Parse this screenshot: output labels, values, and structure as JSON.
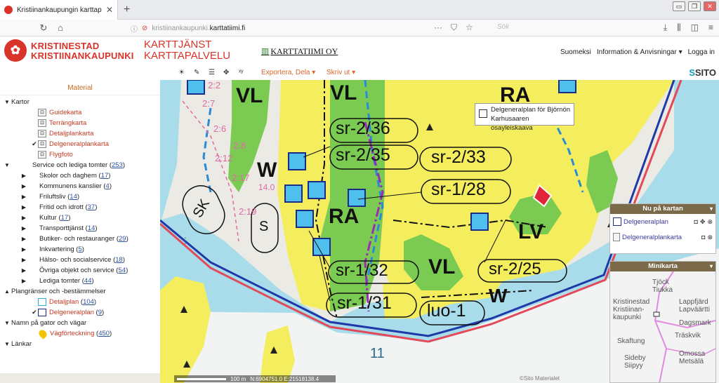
{
  "browser": {
    "tab_title": "Kristiinankaupungin karttapal",
    "url_prefix": "kristiinankaupunki.",
    "url_domain": "karttatiimi.fi",
    "search_placeholder": "Sök"
  },
  "header": {
    "city_line1": "KRISTINESTAD",
    "city_line2": "KRISTIINANKAUPUNKI",
    "service_line1": "KARTTJÄNST",
    "service_line2": "KARTTAPALVELU",
    "provider": "KARTTATIIMI OY",
    "links": [
      "Suomeksi",
      "Information & Anvisningar",
      "Logga in"
    ]
  },
  "toolbar": {
    "export_label": "Exportera, Dela",
    "print_label": "Skriv ut",
    "brand": "SITO"
  },
  "panel": {
    "title": "Material",
    "kartor_label": "Kartor",
    "maps": [
      {
        "label": "Guidekarta",
        "checked": false
      },
      {
        "label": "Terrängkarta",
        "checked": false
      },
      {
        "label": "Detaljplankarta",
        "checked": false
      },
      {
        "label": "Delgeneralplankarta",
        "checked": true
      },
      {
        "label": "Flygfoto",
        "checked": false
      }
    ],
    "service_label": "Service och lediga tomter",
    "service_count": "253",
    "service_items": [
      {
        "label": "Skolor och daghem",
        "count": "17"
      },
      {
        "label": "Kommunens kanslier",
        "count": "4"
      },
      {
        "label": "Friluftsliv",
        "count": "14"
      },
      {
        "label": "Fritid och idrott",
        "count": "37"
      },
      {
        "label": "Kultur",
        "count": "17"
      },
      {
        "label": "Transporttjänst",
        "count": "14"
      },
      {
        "label": "Butiker- och restauranger",
        "count": "29"
      },
      {
        "label": "Inkvartering",
        "count": "5"
      },
      {
        "label": "Hälso- och socialservice",
        "count": "18"
      },
      {
        "label": "Övriga objekt och service",
        "count": "54"
      },
      {
        "label": "Lediga tomter",
        "count": "44"
      }
    ],
    "plan_label": "Plangränser och -bestämmelser",
    "plan_items": [
      {
        "label": "Detaljplan",
        "count": "104",
        "checked": false
      },
      {
        "label": "Delgeneralplan",
        "count": "9",
        "checked": true
      }
    ],
    "roads_label": "Namn på gator och vägar",
    "roads_item": {
      "label": "Vägförteckning",
      "count": "450"
    },
    "links_label": "Länkar"
  },
  "map": {
    "tooltip_line1": "Delgeneralplan för Björnön",
    "tooltip_line2": "Karhusaaren osayleiskaava",
    "labels": [
      "sr-2/36",
      "sr-2/35",
      "sr-2/33",
      "sr-1/28",
      "sr-2/25",
      "sr-1/32",
      "sr-1/31",
      "luo-1",
      "VL",
      "VL",
      "VL",
      "RA",
      "RA",
      "W",
      "W",
      "LV",
      "S",
      "SK",
      "14.0",
      "2:7",
      "2:6",
      "2:8",
      "2:12",
      "2:17",
      "2:19",
      "2:2",
      "11"
    ],
    "scale_label": "100 m",
    "coords": "N:6904751.0 E:21518138.4",
    "copyright": "©Sito Materialet"
  },
  "now_on_map": {
    "title": "Nu på kartan",
    "items": [
      "Delgeneralplan",
      "Delgeneralplankarta"
    ]
  },
  "minimap": {
    "title": "Minikarta",
    "places": [
      "Tjöck",
      "Tiukka",
      "Kristinestad",
      "Kristiinan-",
      "kaupunki",
      "Lappfjärd",
      "Lapväärtti",
      "Dagsmark",
      "Träskvik",
      "Skaftung",
      "Omossa",
      "Metsälä",
      "Sideby",
      "Siipyy"
    ]
  },
  "colors": {
    "brand_red": "#d9332a",
    "orange": "#c96a20",
    "water": "#a8dcea",
    "yellow_zone": "#f4ee5e",
    "green_zone": "#7bcb52",
    "blue_line": "#1f39a8",
    "red_border": "#e24a5a"
  }
}
